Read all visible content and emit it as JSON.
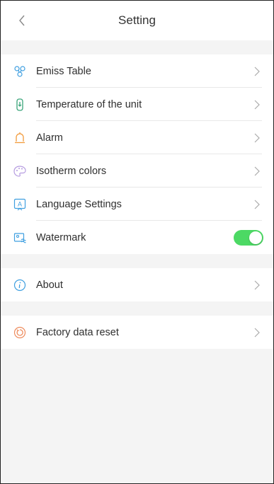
{
  "header": {
    "title": "Setting"
  },
  "settings": {
    "items": [
      {
        "label": "Emiss Table"
      },
      {
        "label": "Temperature of the unit"
      },
      {
        "label": "Alarm"
      },
      {
        "label": "Isotherm colors"
      },
      {
        "label": "Language Settings"
      },
      {
        "label": "Watermark",
        "toggle": "on"
      }
    ]
  },
  "about": {
    "label": "About"
  },
  "reset": {
    "label": "Factory data reset"
  },
  "colors": {
    "accent_blue": "#3f9fe0",
    "toggle_on": "#4cd964",
    "alarm_orange": "#f29a3a",
    "isotherm_purple": "#b59be0",
    "reset_orange": "#ee8b5c"
  }
}
